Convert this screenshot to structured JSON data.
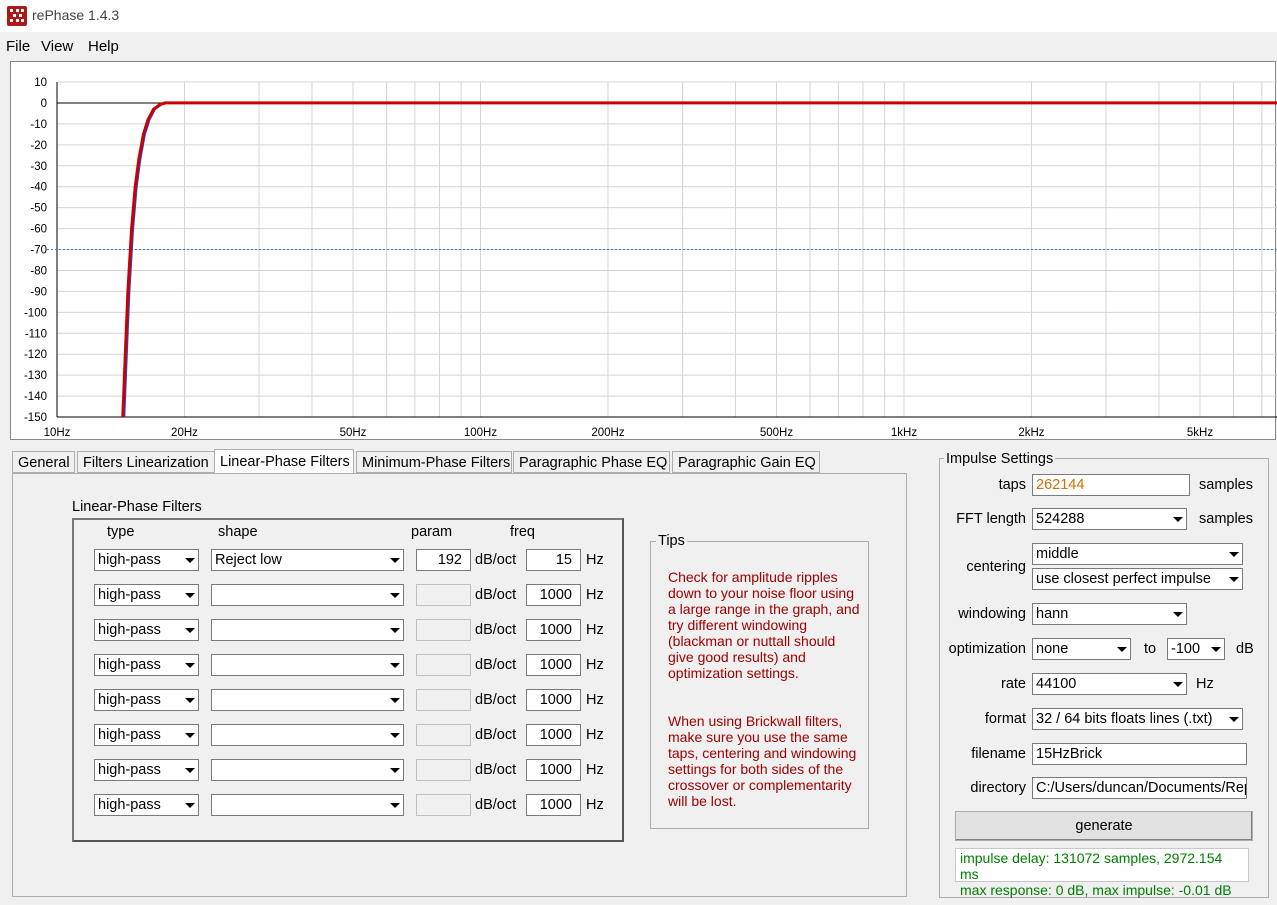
{
  "window": {
    "title": "rePhase 1.4.3"
  },
  "menu": [
    "File",
    "View",
    "Help"
  ],
  "colors": {
    "accent_curve": "#cc0000",
    "phase_curve": "#2244cc",
    "tips_text": "#a00000",
    "status_text": "#008000",
    "taps_text": "#d07000"
  },
  "chart_data": {
    "type": "line",
    "title": "",
    "xlabel": "",
    "ylabel": "",
    "x_scale": "log",
    "xlim": [
      10,
      7600
    ],
    "ylim": [
      -150,
      10
    ],
    "y_ticks": [
      "10",
      "0",
      "-10",
      "-20",
      "-30",
      "-40",
      "-50",
      "-60",
      "-70",
      "-80",
      "-90",
      "-100",
      "-110",
      "-120",
      "-130",
      "-140",
      "-150"
    ],
    "x_ticks": [
      {
        "value": 10,
        "label": "10Hz"
      },
      {
        "value": 20,
        "label": "20Hz"
      },
      {
        "value": 50,
        "label": "50Hz"
      },
      {
        "value": 100,
        "label": "100Hz"
      },
      {
        "value": 200,
        "label": "200Hz"
      },
      {
        "value": 500,
        "label": "500Hz"
      },
      {
        "value": 1000,
        "label": "1kHz"
      },
      {
        "value": 2000,
        "label": "2kHz"
      },
      {
        "value": 5000,
        "label": "5kHz"
      }
    ],
    "reference_line_db": -70,
    "grid": true,
    "series": [
      {
        "x": [
          14.3,
          14.5,
          14.7,
          15.0,
          15.3,
          15.6,
          16.0,
          16.4,
          16.9,
          17.5,
          18.0,
          20,
          50,
          100,
          1000,
          7600
        ],
        "y": [
          -150,
          -120,
          -90,
          -60,
          -40,
          -27,
          -15,
          -8,
          -3,
          -0.8,
          0,
          0,
          0,
          0,
          0,
          0
        ]
      }
    ]
  },
  "tabs": [
    "General",
    "Filters Linearization",
    "Linear-Phase Filters",
    "Minimum-Phase Filters",
    "Paragraphic Phase EQ",
    "Paragraphic Gain EQ"
  ],
  "active_tab": "Linear-Phase Filters",
  "lp": {
    "group_title": "Linear-Phase Filters",
    "headers": {
      "type": "type",
      "shape": "shape",
      "param": "param",
      "freq": "freq"
    },
    "unit_param": "dB/oct",
    "unit_freq": "Hz",
    "rows": [
      {
        "type": "high-pass",
        "shape": "Reject low",
        "param": "192",
        "freq": "15"
      },
      {
        "type": "high-pass",
        "shape": "",
        "param": "",
        "freq": "1000"
      },
      {
        "type": "high-pass",
        "shape": "",
        "param": "",
        "freq": "1000"
      },
      {
        "type": "high-pass",
        "shape": "",
        "param": "",
        "freq": "1000"
      },
      {
        "type": "high-pass",
        "shape": "",
        "param": "",
        "freq": "1000"
      },
      {
        "type": "high-pass",
        "shape": "",
        "param": "",
        "freq": "1000"
      },
      {
        "type": "high-pass",
        "shape": "",
        "param": "",
        "freq": "1000"
      },
      {
        "type": "high-pass",
        "shape": "",
        "param": "",
        "freq": "1000"
      }
    ]
  },
  "tips": {
    "title": "Tips",
    "p1": "Check for amplitude ripples down to your noise floor using a large range in the graph, and try different windowing (blackman or nuttall should give good results) and optimization settings.",
    "p2": "When using Brickwall filters, make sure you use the same taps, centering and windowing settings for both sides of the crossover or complementarity will be lost."
  },
  "impulse": {
    "title": "Impulse Settings",
    "taps_label": "taps",
    "taps": "262144",
    "samples": "samples",
    "fft_label": "FFT length",
    "fft": "524288",
    "centering_label": "centering",
    "centering": "middle",
    "centering2": "use closest perfect impulse",
    "windowing_label": "windowing",
    "windowing": "hann",
    "optimization_label": "optimization",
    "optimization": "none",
    "to": "to",
    "opt_db": "-100",
    "db": "dB",
    "rate_label": "rate",
    "rate": "44100",
    "hz": "Hz",
    "format_label": "format",
    "format": "32 / 64 bits floats lines (.txt)",
    "filename_label": "filename",
    "filename": "15HzBrick",
    "directory_label": "directory",
    "directory": "C:/Users/duncan/Documents/Rep",
    "generate": "generate",
    "status1": "impulse delay: 131072 samples, 2972.154 ms",
    "status2": "max response: 0 dB, max impulse: -0.01 dB"
  }
}
